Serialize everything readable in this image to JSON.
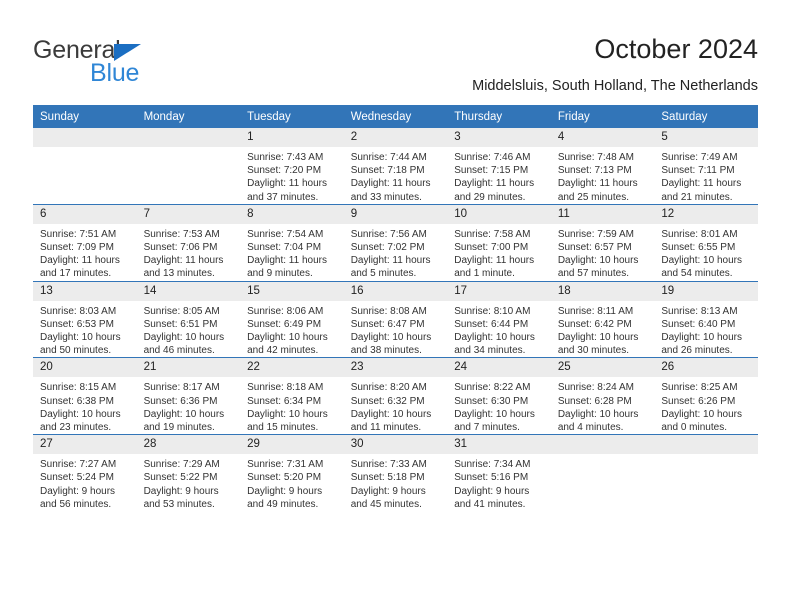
{
  "brand": {
    "name_top": "General",
    "name_bottom": "Blue",
    "color_top": "#3b3b3b",
    "color_bottom": "#2f86d6",
    "triangle_color": "#1b6ec2"
  },
  "header": {
    "title": "October 2024",
    "subtitle": "Middelsluis, South Holland, The Netherlands"
  },
  "theme": {
    "header_bg": "#3275b8",
    "header_text": "#ffffff",
    "daynum_bg": "#ececec",
    "cell_bg": "#ffffff",
    "text": "#222222"
  },
  "weekday_headers": [
    "Sunday",
    "Monday",
    "Tuesday",
    "Wednesday",
    "Thursday",
    "Friday",
    "Saturday"
  ],
  "weeks": [
    [
      {
        "day": "",
        "sunrise": "",
        "sunset": "",
        "daylight1": "",
        "daylight2": "",
        "empty": true
      },
      {
        "day": "",
        "sunrise": "",
        "sunset": "",
        "daylight1": "",
        "daylight2": "",
        "empty": true
      },
      {
        "day": "1",
        "sunrise": "Sunrise: 7:43 AM",
        "sunset": "Sunset: 7:20 PM",
        "daylight1": "Daylight: 11 hours",
        "daylight2": "and 37 minutes.",
        "empty": false
      },
      {
        "day": "2",
        "sunrise": "Sunrise: 7:44 AM",
        "sunset": "Sunset: 7:18 PM",
        "daylight1": "Daylight: 11 hours",
        "daylight2": "and 33 minutes.",
        "empty": false
      },
      {
        "day": "3",
        "sunrise": "Sunrise: 7:46 AM",
        "sunset": "Sunset: 7:15 PM",
        "daylight1": "Daylight: 11 hours",
        "daylight2": "and 29 minutes.",
        "empty": false
      },
      {
        "day": "4",
        "sunrise": "Sunrise: 7:48 AM",
        "sunset": "Sunset: 7:13 PM",
        "daylight1": "Daylight: 11 hours",
        "daylight2": "and 25 minutes.",
        "empty": false
      },
      {
        "day": "5",
        "sunrise": "Sunrise: 7:49 AM",
        "sunset": "Sunset: 7:11 PM",
        "daylight1": "Daylight: 11 hours",
        "daylight2": "and 21 minutes.",
        "empty": false
      }
    ],
    [
      {
        "day": "6",
        "sunrise": "Sunrise: 7:51 AM",
        "sunset": "Sunset: 7:09 PM",
        "daylight1": "Daylight: 11 hours",
        "daylight2": "and 17 minutes.",
        "empty": false
      },
      {
        "day": "7",
        "sunrise": "Sunrise: 7:53 AM",
        "sunset": "Sunset: 7:06 PM",
        "daylight1": "Daylight: 11 hours",
        "daylight2": "and 13 minutes.",
        "empty": false
      },
      {
        "day": "8",
        "sunrise": "Sunrise: 7:54 AM",
        "sunset": "Sunset: 7:04 PM",
        "daylight1": "Daylight: 11 hours",
        "daylight2": "and 9 minutes.",
        "empty": false
      },
      {
        "day": "9",
        "sunrise": "Sunrise: 7:56 AM",
        "sunset": "Sunset: 7:02 PM",
        "daylight1": "Daylight: 11 hours",
        "daylight2": "and 5 minutes.",
        "empty": false
      },
      {
        "day": "10",
        "sunrise": "Sunrise: 7:58 AM",
        "sunset": "Sunset: 7:00 PM",
        "daylight1": "Daylight: 11 hours",
        "daylight2": "and 1 minute.",
        "empty": false
      },
      {
        "day": "11",
        "sunrise": "Sunrise: 7:59 AM",
        "sunset": "Sunset: 6:57 PM",
        "daylight1": "Daylight: 10 hours",
        "daylight2": "and 57 minutes.",
        "empty": false
      },
      {
        "day": "12",
        "sunrise": "Sunrise: 8:01 AM",
        "sunset": "Sunset: 6:55 PM",
        "daylight1": "Daylight: 10 hours",
        "daylight2": "and 54 minutes.",
        "empty": false
      }
    ],
    [
      {
        "day": "13",
        "sunrise": "Sunrise: 8:03 AM",
        "sunset": "Sunset: 6:53 PM",
        "daylight1": "Daylight: 10 hours",
        "daylight2": "and 50 minutes.",
        "empty": false
      },
      {
        "day": "14",
        "sunrise": "Sunrise: 8:05 AM",
        "sunset": "Sunset: 6:51 PM",
        "daylight1": "Daylight: 10 hours",
        "daylight2": "and 46 minutes.",
        "empty": false
      },
      {
        "day": "15",
        "sunrise": "Sunrise: 8:06 AM",
        "sunset": "Sunset: 6:49 PM",
        "daylight1": "Daylight: 10 hours",
        "daylight2": "and 42 minutes.",
        "empty": false
      },
      {
        "day": "16",
        "sunrise": "Sunrise: 8:08 AM",
        "sunset": "Sunset: 6:47 PM",
        "daylight1": "Daylight: 10 hours",
        "daylight2": "and 38 minutes.",
        "empty": false
      },
      {
        "day": "17",
        "sunrise": "Sunrise: 8:10 AM",
        "sunset": "Sunset: 6:44 PM",
        "daylight1": "Daylight: 10 hours",
        "daylight2": "and 34 minutes.",
        "empty": false
      },
      {
        "day": "18",
        "sunrise": "Sunrise: 8:11 AM",
        "sunset": "Sunset: 6:42 PM",
        "daylight1": "Daylight: 10 hours",
        "daylight2": "and 30 minutes.",
        "empty": false
      },
      {
        "day": "19",
        "sunrise": "Sunrise: 8:13 AM",
        "sunset": "Sunset: 6:40 PM",
        "daylight1": "Daylight: 10 hours",
        "daylight2": "and 26 minutes.",
        "empty": false
      }
    ],
    [
      {
        "day": "20",
        "sunrise": "Sunrise: 8:15 AM",
        "sunset": "Sunset: 6:38 PM",
        "daylight1": "Daylight: 10 hours",
        "daylight2": "and 23 minutes.",
        "empty": false
      },
      {
        "day": "21",
        "sunrise": "Sunrise: 8:17 AM",
        "sunset": "Sunset: 6:36 PM",
        "daylight1": "Daylight: 10 hours",
        "daylight2": "and 19 minutes.",
        "empty": false
      },
      {
        "day": "22",
        "sunrise": "Sunrise: 8:18 AM",
        "sunset": "Sunset: 6:34 PM",
        "daylight1": "Daylight: 10 hours",
        "daylight2": "and 15 minutes.",
        "empty": false
      },
      {
        "day": "23",
        "sunrise": "Sunrise: 8:20 AM",
        "sunset": "Sunset: 6:32 PM",
        "daylight1": "Daylight: 10 hours",
        "daylight2": "and 11 minutes.",
        "empty": false
      },
      {
        "day": "24",
        "sunrise": "Sunrise: 8:22 AM",
        "sunset": "Sunset: 6:30 PM",
        "daylight1": "Daylight: 10 hours",
        "daylight2": "and 7 minutes.",
        "empty": false
      },
      {
        "day": "25",
        "sunrise": "Sunrise: 8:24 AM",
        "sunset": "Sunset: 6:28 PM",
        "daylight1": "Daylight: 10 hours",
        "daylight2": "and 4 minutes.",
        "empty": false
      },
      {
        "day": "26",
        "sunrise": "Sunrise: 8:25 AM",
        "sunset": "Sunset: 6:26 PM",
        "daylight1": "Daylight: 10 hours",
        "daylight2": "and 0 minutes.",
        "empty": false
      }
    ],
    [
      {
        "day": "27",
        "sunrise": "Sunrise: 7:27 AM",
        "sunset": "Sunset: 5:24 PM",
        "daylight1": "Daylight: 9 hours",
        "daylight2": "and 56 minutes.",
        "empty": false
      },
      {
        "day": "28",
        "sunrise": "Sunrise: 7:29 AM",
        "sunset": "Sunset: 5:22 PM",
        "daylight1": "Daylight: 9 hours",
        "daylight2": "and 53 minutes.",
        "empty": false
      },
      {
        "day": "29",
        "sunrise": "Sunrise: 7:31 AM",
        "sunset": "Sunset: 5:20 PM",
        "daylight1": "Daylight: 9 hours",
        "daylight2": "and 49 minutes.",
        "empty": false
      },
      {
        "day": "30",
        "sunrise": "Sunrise: 7:33 AM",
        "sunset": "Sunset: 5:18 PM",
        "daylight1": "Daylight: 9 hours",
        "daylight2": "and 45 minutes.",
        "empty": false
      },
      {
        "day": "31",
        "sunrise": "Sunrise: 7:34 AM",
        "sunset": "Sunset: 5:16 PM",
        "daylight1": "Daylight: 9 hours",
        "daylight2": "and 41 minutes.",
        "empty": false
      },
      {
        "day": "",
        "sunrise": "",
        "sunset": "",
        "daylight1": "",
        "daylight2": "",
        "empty": true
      },
      {
        "day": "",
        "sunrise": "",
        "sunset": "",
        "daylight1": "",
        "daylight2": "",
        "empty": true
      }
    ]
  ]
}
